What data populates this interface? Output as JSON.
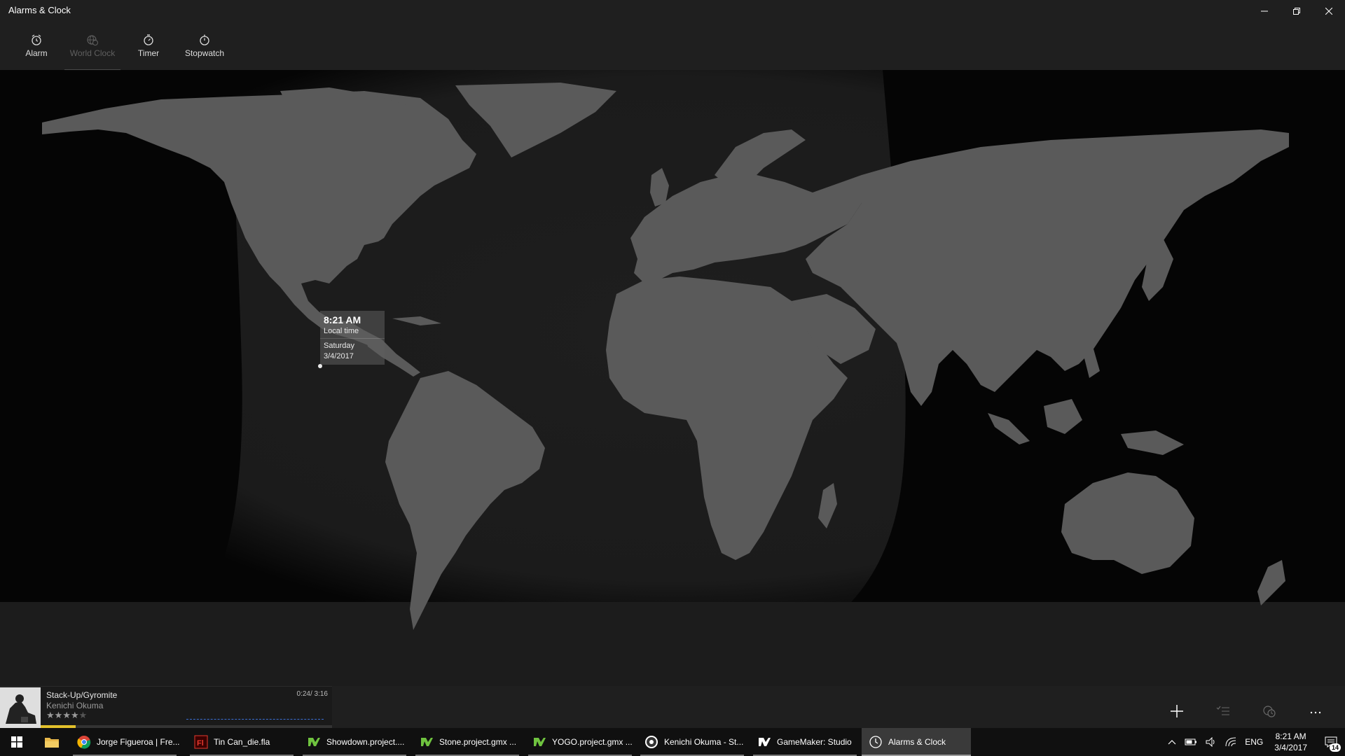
{
  "app": {
    "title": "Alarms & Clock"
  },
  "window_controls": [
    "minimize-icon",
    "restore-icon",
    "close-icon"
  ],
  "tabs": [
    {
      "label": "Alarm",
      "icon": "alarm-icon",
      "active": false
    },
    {
      "label": "World Clock",
      "icon": "globe-clock-icon",
      "active": true
    },
    {
      "label": "Timer",
      "icon": "timer-icon",
      "active": false
    },
    {
      "label": "Stopwatch",
      "icon": "stopwatch-icon",
      "active": false
    }
  ],
  "tooltip": {
    "time": "8:21 AM",
    "label": "Local time",
    "day": "Saturday",
    "date": "3/4/2017"
  },
  "app_bar": {
    "buttons": [
      "add-icon",
      "select-icon",
      "compare-icon",
      "more-icon"
    ]
  },
  "player": {
    "song": "Stack-Up/Gyromite",
    "artist": "Kenichi Okuma",
    "time": "0:24/ 3:16",
    "rating": 4,
    "rating_max": 5,
    "progress": 0.12,
    "star_filled": "★",
    "star_empty": "★"
  },
  "taskbar": {
    "items": [
      {
        "label": "Jorge Figueroa | Fre...",
        "icon": "chrome-icon",
        "active": false
      },
      {
        "label": "Tin Can_die.fla",
        "icon": "flash-icon",
        "active": false
      },
      {
        "label": "Showdown.project....",
        "icon": "gamemaker-icon",
        "active": false
      },
      {
        "label": "Stone.project.gmx ...",
        "icon": "gamemaker-icon",
        "active": false
      },
      {
        "label": "YOGO.project.gmx ...",
        "icon": "gamemaker-icon",
        "active": false
      },
      {
        "label": "Kenichi Okuma - St...",
        "icon": "media-player-icon",
        "active": false
      },
      {
        "label": "GameMaker: Studio",
        "icon": "gamemaker-studio-icon",
        "active": false
      },
      {
        "label": "Alarms & Clock",
        "icon": "alarms-clock-icon",
        "active": true
      }
    ],
    "tray": {
      "language": "ENG",
      "time": "8:21 AM",
      "date": "3/4/2017",
      "notification_count": "14"
    }
  },
  "colors": {
    "land": "#5a5a5a",
    "ocean_day": "#1c1c1c",
    "ocean_night": "#050505",
    "progress": "#e3c12b"
  }
}
